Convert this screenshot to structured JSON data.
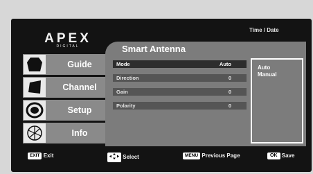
{
  "brand": {
    "logo_text": "APEX",
    "sub_text": "DIGITAL"
  },
  "header": {
    "time_date": "Time / Date",
    "menu_title": "Smart Antenna"
  },
  "sidebar": {
    "items": [
      {
        "label": "Guide",
        "icon": "guide-icon"
      },
      {
        "label": "Channel",
        "icon": "channel-icon"
      },
      {
        "label": "Setup",
        "icon": "setup-icon"
      },
      {
        "label": "Info",
        "icon": "info-icon"
      }
    ]
  },
  "settings": [
    {
      "label": "Mode",
      "value": "Auto",
      "selected": true
    },
    {
      "label": "Direction",
      "value": "0"
    },
    {
      "label": "Gain",
      "value": "0"
    },
    {
      "label": "Polarity",
      "value": "0"
    }
  ],
  "options": [
    "Auto",
    "Manual"
  ],
  "footer": {
    "exit_key": "EXIT",
    "exit_label": "Exit",
    "select_label": "Select",
    "menu_key": "MENU",
    "menu_label": "Previous Page",
    "ok_key": "OK",
    "ok_label": "Save"
  },
  "colors": {
    "panel": "#7c7c7c",
    "selected_row": "#2d2d2d",
    "row": "#555555",
    "background": "#131313"
  }
}
